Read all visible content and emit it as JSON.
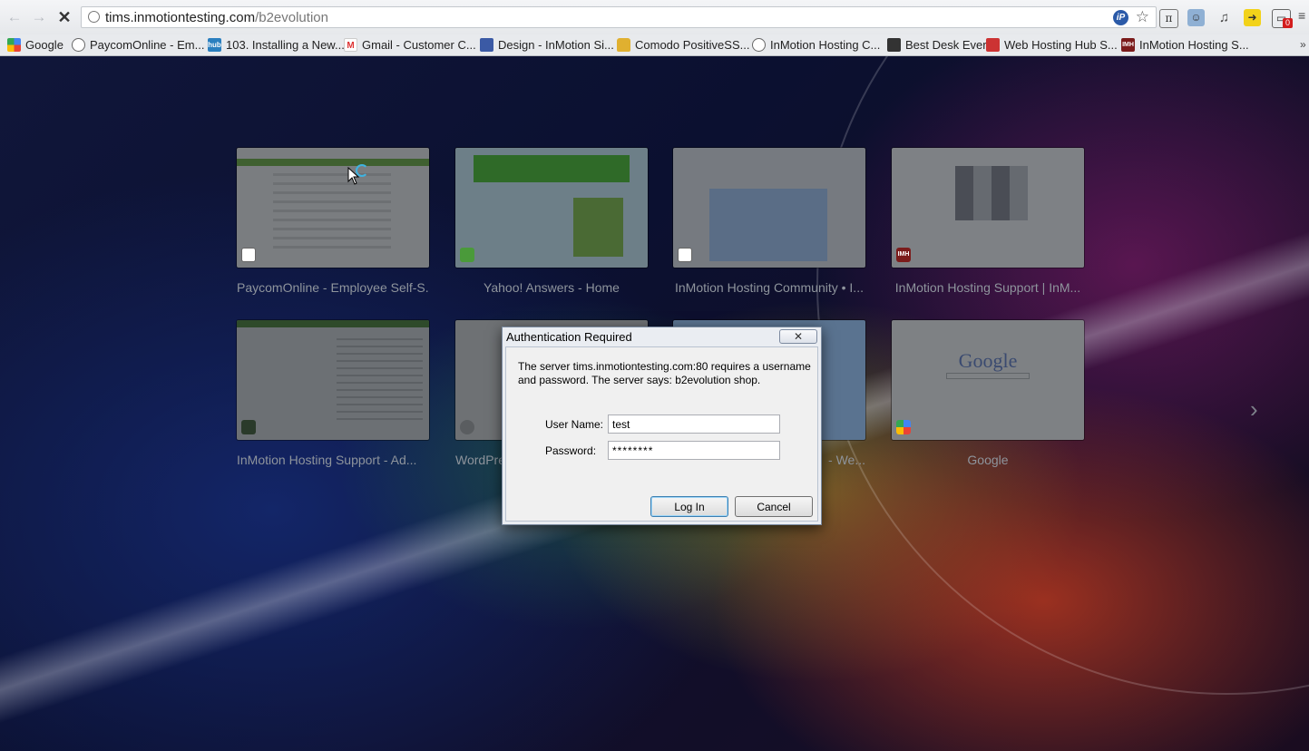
{
  "browser": {
    "url_host": "tims.inmotiontesting.com",
    "url_path": "/b2evolution",
    "ip_icon_text": "iP",
    "extension_badge": "0"
  },
  "bookmarks": [
    {
      "label": "Google",
      "icon": "google-icon"
    },
    {
      "label": "PaycomOnline - Em...",
      "icon": "globe-icon"
    },
    {
      "label": "103. Installing a New...",
      "icon": "hub-icon"
    },
    {
      "label": "Gmail - Customer C...",
      "icon": "gmail-icon"
    },
    {
      "label": "Design - InMotion Si...",
      "icon": "design-icon"
    },
    {
      "label": "Comodo PositiveSS...",
      "icon": "lock-icon"
    },
    {
      "label": "InMotion Hosting C...",
      "icon": "globe-icon"
    },
    {
      "label": "Best Desk Ever",
      "icon": "desk-icon"
    },
    {
      "label": "Web Hosting Hub S...",
      "icon": "whh-icon"
    },
    {
      "label": "InMotion Hosting S...",
      "icon": "imh-icon"
    }
  ],
  "bookmark_icon_text": {
    "hub": "hub",
    "gmail": "M",
    "imh": "IMH"
  },
  "tiles": [
    {
      "title": "PaycomOnline - Employee Self-S..."
    },
    {
      "title": "Yahoo! Answers - Home"
    },
    {
      "title": "InMotion Hosting Community • I..."
    },
    {
      "title": "InMotion Hosting Support | InM..."
    },
    {
      "title": "InMotion Hosting Support - Ad..."
    },
    {
      "title": "WordPre"
    },
    {
      "title": " - We..."
    },
    {
      "title": "Google"
    }
  ],
  "thumb_text": {
    "google_logo": "Google",
    "imh_fav": "IMH"
  },
  "dialog": {
    "title": "Authentication Required",
    "close_glyph": "✕",
    "message": "The server tims.inmotiontesting.com:80 requires a username and password. The server says: b2evolution shop.",
    "username_label": "User Name:",
    "username_value": "test",
    "password_label": "Password:",
    "password_value": "********",
    "login_label": "Log In",
    "cancel_label": "Cancel"
  },
  "colors": {
    "accent": "#3c7fb1",
    "busy_ring": "#3fb3e0"
  }
}
